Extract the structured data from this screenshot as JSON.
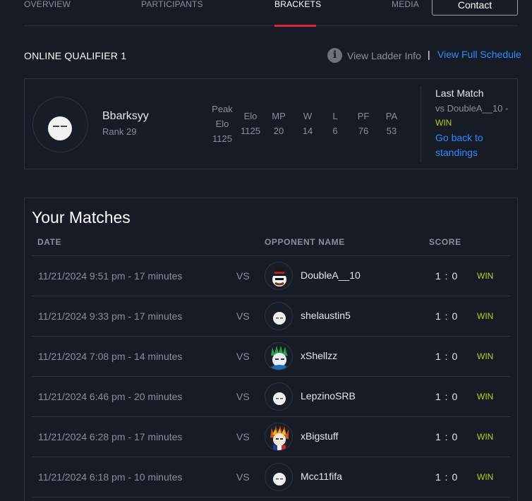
{
  "nav": {
    "tabs": [
      {
        "label": "OVERVIEW",
        "active": false
      },
      {
        "label": "PARTICIPANTS",
        "active": false
      },
      {
        "label": "BRACKETS",
        "active": true
      },
      {
        "label": "MEDIA",
        "active": false
      }
    ],
    "contact_label": "Contact"
  },
  "ladder": {
    "title": "ONLINE QUALIFIER 1",
    "info_icon": "i",
    "view_info_label": "View Ladder Info",
    "separator": "|",
    "view_schedule_label": "View Full Schedule"
  },
  "player": {
    "name": "Bbarksyy",
    "rank": "Rank 29",
    "stats": [
      {
        "label": "Peak Elo",
        "value": "1125"
      },
      {
        "label": "Elo",
        "value": "1125"
      },
      {
        "label": "MP",
        "value": "20"
      },
      {
        "label": "W",
        "value": "14"
      },
      {
        "label": "L",
        "value": "6"
      },
      {
        "label": "PF",
        "value": "76"
      },
      {
        "label": "PA",
        "value": "53"
      }
    ],
    "last_match": {
      "title": "Last Match",
      "opponent": "vs DoubleA__10 -",
      "result": "WIN",
      "back_label": "Go back to standings"
    }
  },
  "matches": {
    "title": "Your Matches",
    "columns": {
      "date": "DATE",
      "opponent": "OPPONENT NAME",
      "score": "SCORE"
    },
    "rows": [
      {
        "date": "11/21/2024 9:51 pm - 17 minutes",
        "vs": "VS",
        "opponent": "DoubleA__10",
        "avatar": "top-hat-avatar-icon",
        "score": "1 : 0",
        "result": "WIN"
      },
      {
        "date": "11/21/2024 9:33 pm - 17 minutes",
        "vs": "VS",
        "opponent": "shelaustin5",
        "avatar": "default-face-avatar-icon",
        "score": "1 : 0",
        "result": "WIN"
      },
      {
        "date": "11/21/2024 7:08 pm - 14 minutes",
        "vs": "VS",
        "opponent": "xShellzz",
        "avatar": "green-crown-avatar-icon",
        "score": "1 : 0",
        "result": "WIN"
      },
      {
        "date": "11/21/2024 6:46 pm - 20 minutes",
        "vs": "VS",
        "opponent": "LepzinoSRB",
        "avatar": "default-face-avatar-icon",
        "score": "1 : 0",
        "result": "WIN"
      },
      {
        "date": "11/21/2024 6:28 pm - 17 minutes",
        "vs": "VS",
        "opponent": "xBigstuff",
        "avatar": "feather-headdress-avatar-icon",
        "score": "1 : 0",
        "result": "WIN"
      },
      {
        "date": "11/21/2024 6:18 pm - 10 minutes",
        "vs": "VS",
        "opponent": "Mcc11fifa",
        "avatar": "default-face-avatar-icon",
        "score": "1 : 0",
        "result": "WIN"
      }
    ]
  },
  "colors": {
    "accent_red": "#e0253a",
    "link_blue": "#2f8cff",
    "win_green": "#b5d21e",
    "background": "#171b26"
  }
}
